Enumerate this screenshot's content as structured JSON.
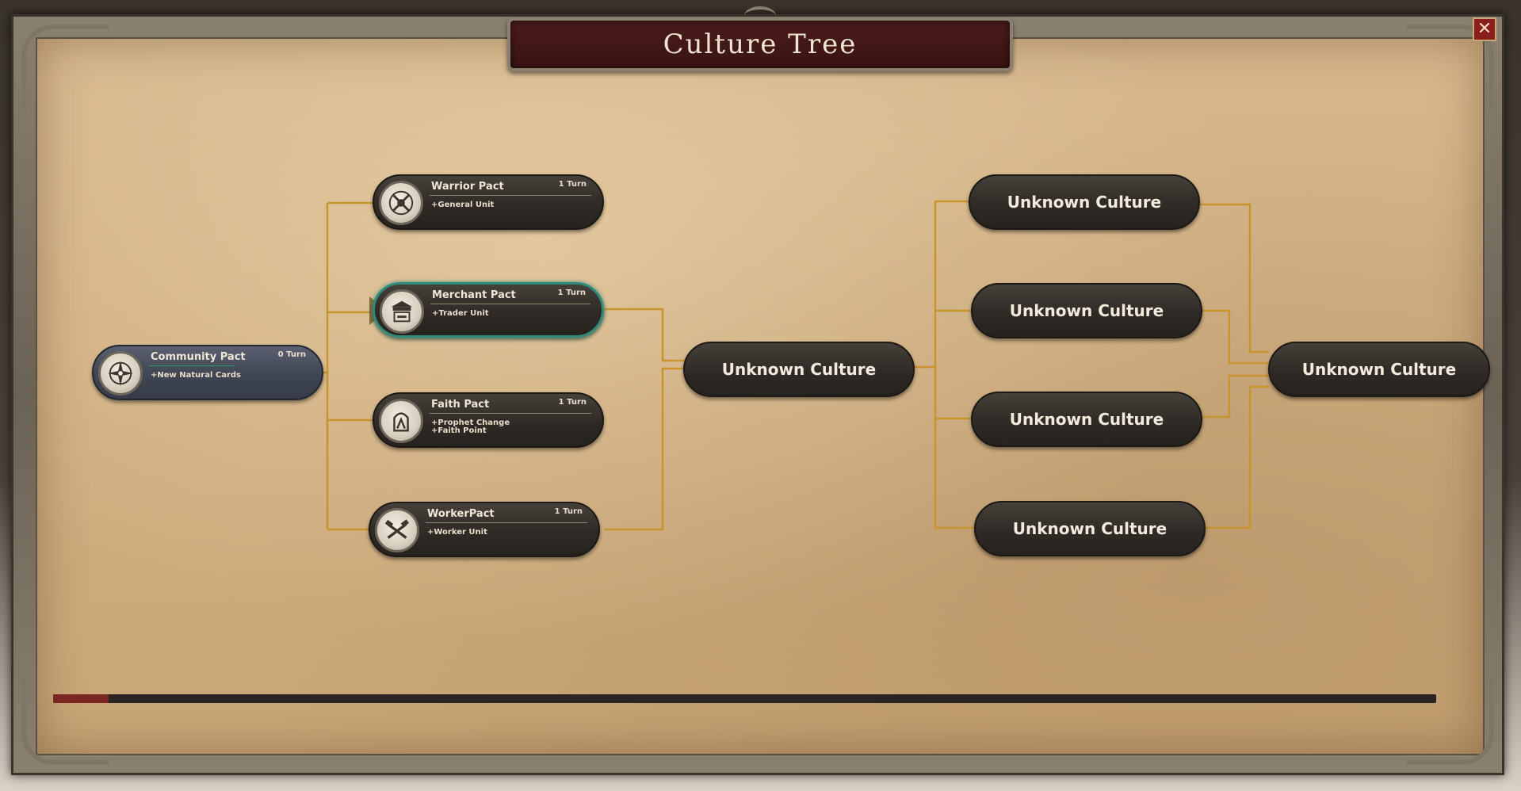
{
  "window": {
    "title": "Culture Tree",
    "close_label": "✕"
  },
  "colors": {
    "connector": "#c8942e",
    "node_dark": "#2f2a25",
    "node_community": "#3f4552",
    "selected_border": "#2f8a7a",
    "title_bar": "#3a1413",
    "scroll_thumb": "#7a2622"
  },
  "root": {
    "name": "Community Pact",
    "turns": "0 Turn",
    "effects": [
      "+New Natural Cards"
    ],
    "icon": "compass-rose-icon"
  },
  "pacts": [
    {
      "name": "Warrior Pact",
      "turns": "1 Turn",
      "effects": [
        "+General Unit"
      ],
      "icon": "crossed-swords-icon"
    },
    {
      "name": "Merchant Pact",
      "turns": "1 Turn",
      "effects": [
        "+Trader Unit"
      ],
      "icon": "market-stall-icon",
      "selected": true
    },
    {
      "name": "Faith Pact",
      "turns": "1 Turn",
      "effects": [
        "+Prophet Change",
        "+Faith Point"
      ],
      "icon": "praying-hands-icon"
    },
    {
      "name": "WorkerPact",
      "turns": "1 Turn",
      "effects": [
        "+Worker Unit"
      ],
      "icon": "hammers-icon"
    }
  ],
  "unknown_middle": {
    "label": "Unknown Culture"
  },
  "unknown_column": [
    {
      "label": "Unknown Culture"
    },
    {
      "label": "Unknown Culture"
    },
    {
      "label": "Unknown Culture"
    },
    {
      "label": "Unknown Culture"
    }
  ],
  "unknown_final": {
    "label": "Unknown Culture"
  },
  "scrollbar": {
    "position": 0.0,
    "thumb_fraction": 0.04
  }
}
